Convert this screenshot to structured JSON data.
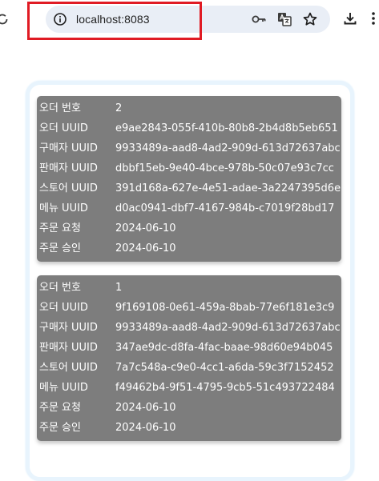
{
  "browser": {
    "url": "localhost:8083"
  },
  "orders": [
    {
      "rows": [
        {
          "label": "오더 번호",
          "value": "2"
        },
        {
          "label": "오더 UUID",
          "value": "e9ae2843-055f-410b-80b8-2b4d8b5eb651"
        },
        {
          "label": "구매자 UUID",
          "value": "9933489a-aad8-4ad2-909d-613d72637abc"
        },
        {
          "label": "판매자 UUID",
          "value": "dbbf15eb-9e40-4bce-978b-50c07e93c7cc"
        },
        {
          "label": "스토어 UUID",
          "value": "391d168a-627e-4e51-adae-3a2247395d6e"
        },
        {
          "label": "메뉴 UUID",
          "value": "d0ac0941-dbf7-4167-984b-c7019f28bd17"
        },
        {
          "label": "주문 요청",
          "value": "2024-06-10"
        },
        {
          "label": "주문 승인",
          "value": "2024-06-10"
        }
      ]
    },
    {
      "rows": [
        {
          "label": "오더 번호",
          "value": "1"
        },
        {
          "label": "오더 UUID",
          "value": "9f169108-0e61-459a-8bab-77e6f181e3c9"
        },
        {
          "label": "구매자 UUID",
          "value": "9933489a-aad8-4ad2-909d-613d72637abc"
        },
        {
          "label": "판매자 UUID",
          "value": "347ae9dc-d8fa-4fac-baae-98d60e94b045"
        },
        {
          "label": "스토어 UUID",
          "value": "7a7c548a-c9e0-4cc1-a6da-59c3f7152452"
        },
        {
          "label": "메뉴 UUID",
          "value": "f49462b4-9f51-4795-9cb5-51c493722484"
        },
        {
          "label": "주문 요청",
          "value": "2024-06-10"
        },
        {
          "label": "주문 승인",
          "value": "2024-06-10"
        }
      ]
    }
  ],
  "colors": {
    "card_background": "#7d7d7d",
    "highlight": "#e01b24",
    "omnibox": "#e9eef6"
  }
}
